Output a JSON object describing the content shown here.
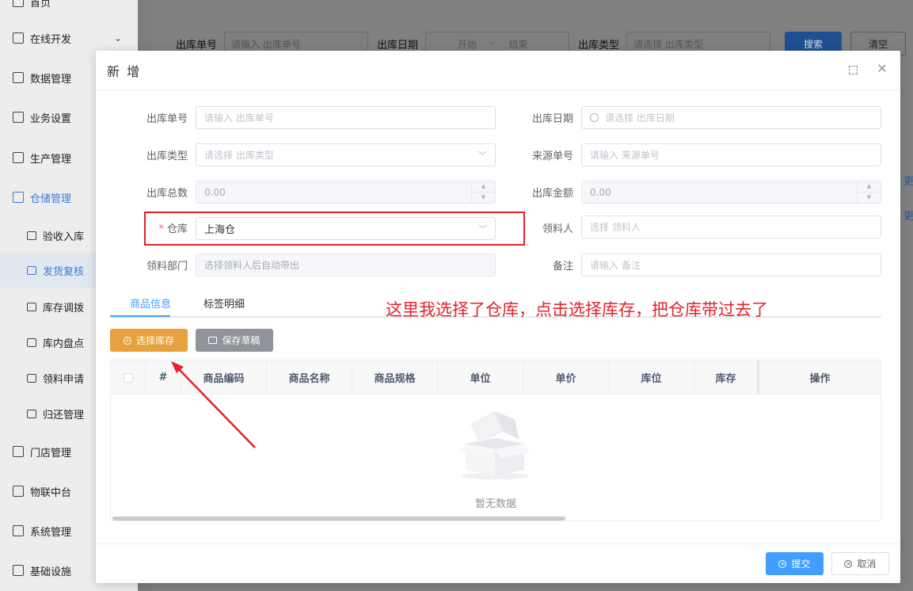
{
  "sidebar": {
    "items": [
      {
        "label": "首页",
        "icon": "home-icon"
      },
      {
        "label": "在线开发",
        "icon": "code-icon",
        "chevron": "⌄"
      },
      {
        "label": "数据管理",
        "icon": "database-icon"
      },
      {
        "label": "业务设置",
        "icon": "briefcase-icon"
      },
      {
        "label": "生产管理",
        "icon": "factory-icon"
      },
      {
        "label": "仓储管理",
        "icon": "truck-icon"
      },
      {
        "label": "验收入库",
        "icon": "cart-icon"
      },
      {
        "label": "发货复核",
        "icon": "cart-icon"
      },
      {
        "label": "库存调拨",
        "icon": "cart-icon"
      },
      {
        "label": "库内盘点",
        "icon": "calendar-icon"
      },
      {
        "label": "领料申请",
        "icon": "bag-icon"
      },
      {
        "label": "归还管理",
        "icon": "bag-icon"
      },
      {
        "label": "门店管理",
        "icon": "store-icon"
      },
      {
        "label": "物联中台",
        "icon": "gear-icon"
      },
      {
        "label": "系统管理",
        "icon": "grid-icon"
      },
      {
        "label": "基础设施",
        "icon": "gear-icon"
      }
    ]
  },
  "background_search": {
    "order_no_label": "出库单号",
    "order_no_placeholder": "请输入 出库单号",
    "date_label": "出库日期",
    "date_start": "开始",
    "date_sep": "-",
    "date_end": "结束",
    "type_label": "出库类型",
    "type_placeholder": "请选择 出库类型",
    "search_button": "搜索",
    "clear_button": "清空",
    "side_text_1": "更",
    "side_text_2": "更"
  },
  "modal": {
    "title": "新 增",
    "fields": {
      "order_no": {
        "label": "出库单号",
        "placeholder": "请输入 出库单号"
      },
      "date": {
        "label": "出库日期",
        "placeholder": "请选择 出库日期"
      },
      "type": {
        "label": "出库类型",
        "placeholder": "请选择 出库类型"
      },
      "source_no": {
        "label": "来源单号",
        "placeholder": "请输入 来源单号"
      },
      "total_qty": {
        "label": "出库总数",
        "value": "0.00"
      },
      "amount": {
        "label": "出库金额",
        "value": "0.00"
      },
      "warehouse": {
        "label": "仓库",
        "required_mark": "*",
        "value": "上海仓"
      },
      "receiver": {
        "label": "领料人",
        "placeholder": "选择 领料人"
      },
      "department": {
        "label": "领料部门",
        "placeholder": "选择领料人后自动带出"
      },
      "remark": {
        "label": "备注",
        "placeholder": "请输入 备注"
      }
    },
    "tabs": [
      {
        "label": "商品信息",
        "active": true
      },
      {
        "label": "标签明细",
        "active": false
      }
    ],
    "annotation": "这里我选择了仓库，点击选择库存，把仓库带过去了",
    "buttons": {
      "select_stock": "选择库存",
      "save_draft": "保存草稿",
      "submit": "提交",
      "cancel": "取消"
    },
    "table": {
      "columns": [
        "#",
        "商品编码",
        "商品名称",
        "商品规格",
        "单位",
        "单价",
        "库位",
        "库存",
        "操作"
      ],
      "empty_text": "暂无数据"
    }
  },
  "colors": {
    "primary": "#409eff",
    "warning": "#e6a23c",
    "info": "#909399",
    "annotation_red": "#e6212a"
  }
}
